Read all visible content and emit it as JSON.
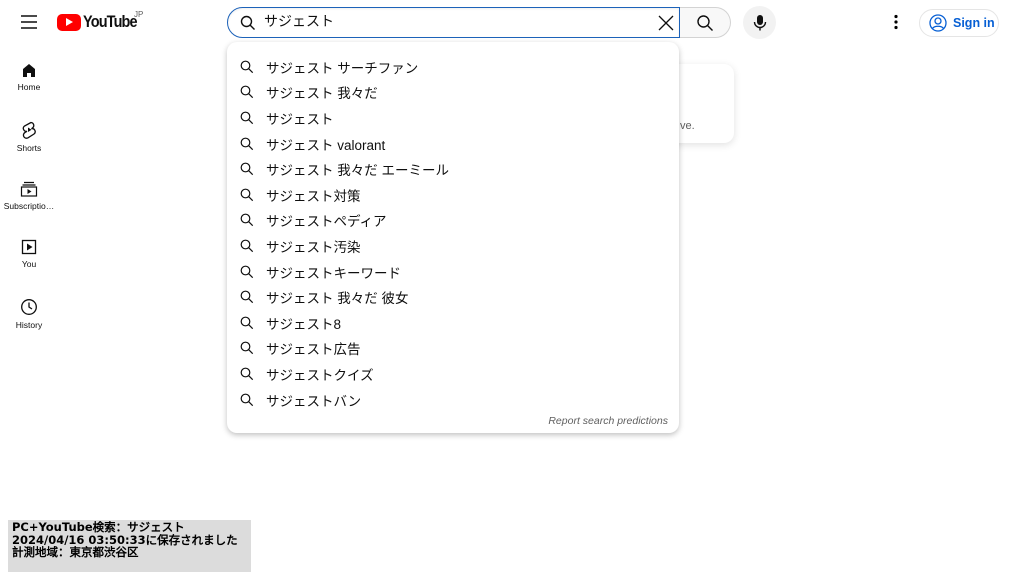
{
  "header": {
    "logo_text": "YouTube",
    "region": "JP",
    "search_value": "サジェスト",
    "sign_in": "Sign in"
  },
  "sidebar": {
    "items": [
      {
        "label": "Home",
        "icon": "home-icon"
      },
      {
        "label": "Shorts",
        "icon": "shorts-icon"
      },
      {
        "label": "Subscriptio…",
        "icon": "subscriptions-icon"
      },
      {
        "label": "You",
        "icon": "you-icon"
      },
      {
        "label": "History",
        "icon": "history-icon"
      }
    ]
  },
  "card": {
    "text": "ve."
  },
  "suggestions": [
    "サジェスト サーチファン",
    "サジェスト 我々だ",
    "サジェスト",
    "サジェスト valorant",
    "サジェスト 我々だ エーミール",
    "サジェスト対策",
    "サジェストペディア",
    "サジェスト汚染",
    "サジェストキーワード",
    "サジェスト 我々だ 彼女",
    "サジェスト8",
    "サジェスト広告",
    "サジェストクイズ",
    "サジェストバン"
  ],
  "report_label": "Report search predictions",
  "note": {
    "line1": "PC+YouTube検索：サジェスト",
    "line2": "2024/04/16 03:50:33に保存されました",
    "line3": "計測地域：東京都渋谷区"
  },
  "colors": {
    "accent": "#065fd4",
    "brand": "#ff0000",
    "focus": "#1c62b9"
  }
}
